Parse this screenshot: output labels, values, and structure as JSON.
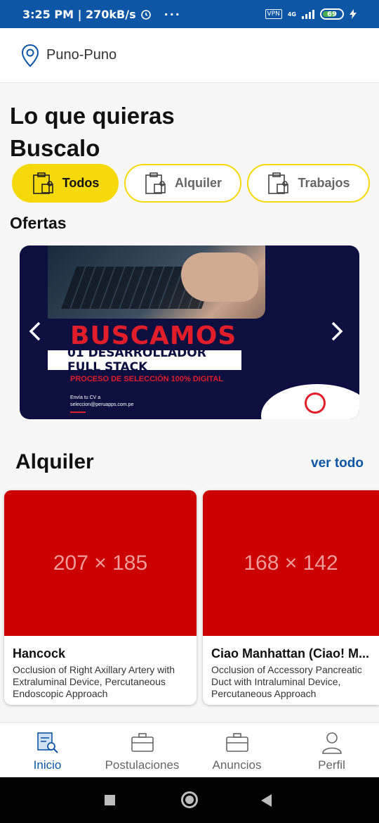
{
  "status_bar": {
    "time": "3:25 PM | 270kB/s",
    "vpn": "VPN",
    "network": "4G",
    "battery": "69",
    "icons": [
      "alarm-icon",
      "more-dots-icon",
      "signal-icon",
      "charging-icon"
    ]
  },
  "location": {
    "label": "Puno-Puno",
    "icon": "map-pin-icon"
  },
  "hero": {
    "line1": "Lo que quieras",
    "line2": "Buscalo"
  },
  "filters": [
    {
      "label": "Todos",
      "active": true,
      "icon": "briefcase-box-icon"
    },
    {
      "label": "Alquiler",
      "active": false,
      "icon": "briefcase-box-icon"
    },
    {
      "label": "Trabajos",
      "active": false,
      "icon": "briefcase-box-icon"
    }
  ],
  "ofertas": {
    "title": "Ofertas",
    "banner": {
      "headline": "BUSCAMOS",
      "role": "01 DESARROLLADOR FULL STACK",
      "process": "PROCESO DE SELECCIÓN 100% DIGITAL",
      "send_label": "Envía tu CV a",
      "email": "seleccion@peruapps.com.pe"
    },
    "prev_icon": "chevron-left-icon",
    "next_icon": "chevron-right-icon"
  },
  "alquiler": {
    "title": "Alquiler",
    "see_all": "ver todo",
    "cards": [
      {
        "placeholder": "207 × 185",
        "title": "Hancock",
        "desc": "Occlusion of Right Axillary Artery with Extraluminal Device, Percutaneous Endoscopic Approach"
      },
      {
        "placeholder": "168 × 142",
        "title": "Ciao Manhattan (Ciao! M...",
        "desc": "Occlusion of Accessory Pancreatic Duct with Intraluminal Device, Percutaneous Approach"
      }
    ]
  },
  "bottom_nav": [
    {
      "label": "Inicio",
      "active": true,
      "icon": "document-search-icon"
    },
    {
      "label": "Postulaciones",
      "active": false,
      "icon": "briefcase-icon"
    },
    {
      "label": "Anuncios",
      "active": false,
      "icon": "briefcase-icon"
    },
    {
      "label": "Perfil",
      "active": false,
      "icon": "user-icon"
    }
  ],
  "colors": {
    "primary": "#0d56a6",
    "accent": "#f5d90a",
    "placeholder_red": "#cc0000",
    "banner_navy": "#0c0f3f"
  }
}
